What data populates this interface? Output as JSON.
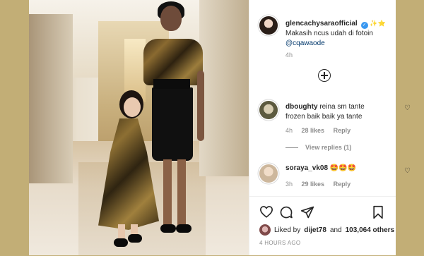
{
  "post": {
    "username": "glencachysaraofficial",
    "caption_emojis": "✨⭐",
    "caption_text": "Makasih ncus udah di fotoin",
    "caption_mention": "@cqawaode",
    "caption_time": "4h",
    "time_ago": "4 HOURS AGO"
  },
  "comments": [
    {
      "username": "dboughty",
      "text": "reina sm tante frozen baik baik ya tante",
      "time": "4h",
      "likes": "28 likes",
      "reply": "Reply",
      "view_replies": "View replies (1)"
    },
    {
      "username": "soraya_vk08",
      "text": "🤩🤩🤩",
      "time": "3h",
      "likes": "29 likes",
      "reply": "Reply"
    }
  ],
  "likes": {
    "prefix": "Liked by",
    "user": "dijet78",
    "middle": "and",
    "count": "103,064 others"
  },
  "icons": {
    "heart": "heart-icon",
    "comment": "comment-icon",
    "share": "share-icon",
    "save": "bookmark-icon",
    "add": "add-comment-icon",
    "verified": "verified-badge-icon"
  },
  "colors": {
    "background": "#c2ae76",
    "verified": "#3897f0",
    "mention": "#00376b"
  }
}
